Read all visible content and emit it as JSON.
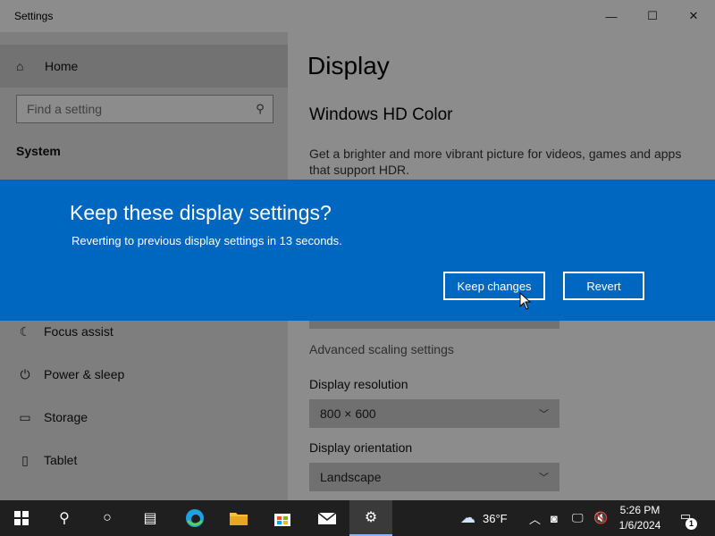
{
  "window": {
    "title": "Settings",
    "controls": {
      "minimize": "—",
      "maximize": "☐",
      "close": "✕"
    }
  },
  "sidebar": {
    "home_label": "Home",
    "home_icon": "home-icon",
    "search_placeholder": "Find a setting",
    "section_title": "System",
    "items": [
      {
        "label": "Focus assist",
        "icon": "moon-icon",
        "glyph": "☾"
      },
      {
        "label": "Power & sleep",
        "icon": "power-icon",
        "glyph": "⏻"
      },
      {
        "label": "Storage",
        "icon": "storage-icon",
        "glyph": "▭"
      },
      {
        "label": "Tablet",
        "icon": "tablet-icon",
        "glyph": "▯"
      }
    ]
  },
  "content": {
    "page_title": "Display",
    "hdr_heading": "Windows HD Color",
    "hdr_description": "Get a brighter and more vibrant picture for videos, games and apps that support HDR.",
    "advanced_scaling_link": "Advanced scaling settings",
    "resolution_label": "Display resolution",
    "resolution_value": "800 × 600",
    "orientation_label": "Display orientation",
    "orientation_value": "Landscape"
  },
  "dialog": {
    "title": "Keep these display settings?",
    "message": "Reverting to previous display settings in 13 seconds.",
    "keep_label": "Keep changes",
    "revert_label": "Revert",
    "background_color": "#0067c0"
  },
  "taskbar": {
    "weather_temp": "36°F",
    "time": "5:26 PM",
    "date": "1/6/2024",
    "notification_count": "1",
    "apps": [
      "start-icon",
      "search-icon",
      "cortana-icon",
      "task-view-icon",
      "edge-icon",
      "file-explorer-icon",
      "store-icon",
      "mail-icon",
      "settings-icon"
    ]
  }
}
